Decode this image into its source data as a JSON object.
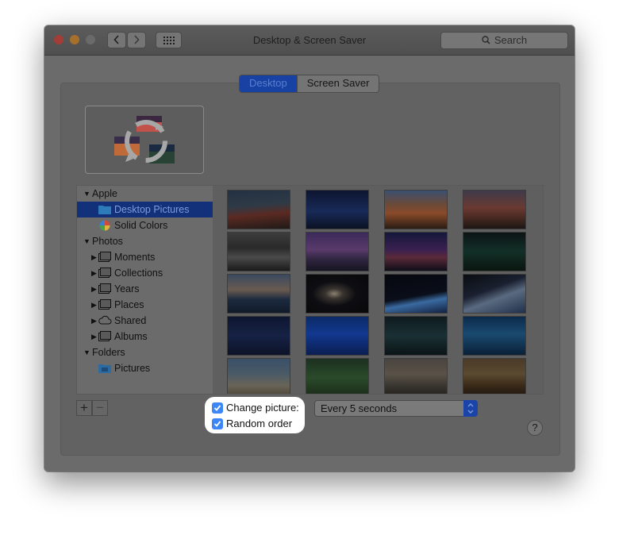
{
  "window": {
    "title": "Desktop & Screen Saver"
  },
  "toolbar": {
    "back_icon": "chevron-left",
    "forward_icon": "chevron-right",
    "grid_icon": "show-all-grid",
    "search_placeholder": "Search"
  },
  "tabs": [
    {
      "label": "Desktop",
      "selected": true
    },
    {
      "label": "Screen Saver",
      "selected": false
    }
  ],
  "sidebar": {
    "apple": {
      "label": "Apple",
      "items": [
        {
          "label": "Desktop Pictures",
          "selected": true
        },
        {
          "label": "Solid Colors"
        }
      ]
    },
    "photos": {
      "label": "Photos",
      "items": [
        {
          "label": "Moments"
        },
        {
          "label": "Collections"
        },
        {
          "label": "Years"
        },
        {
          "label": "Places"
        },
        {
          "label": "Shared"
        },
        {
          "label": "Albums"
        }
      ]
    },
    "folders": {
      "label": "Folders",
      "items": [
        {
          "label": "Pictures"
        }
      ]
    }
  },
  "controls": {
    "add_label": "+",
    "remove_label": "−",
    "change_picture": {
      "label": "Change picture:",
      "checked": true
    },
    "random_order": {
      "label": "Random order",
      "checked": true
    },
    "interval": {
      "value": "Every 5 seconds"
    },
    "help_label": "?"
  },
  "colors": {
    "accent": "#3d86f5",
    "selection": "#13307a"
  }
}
